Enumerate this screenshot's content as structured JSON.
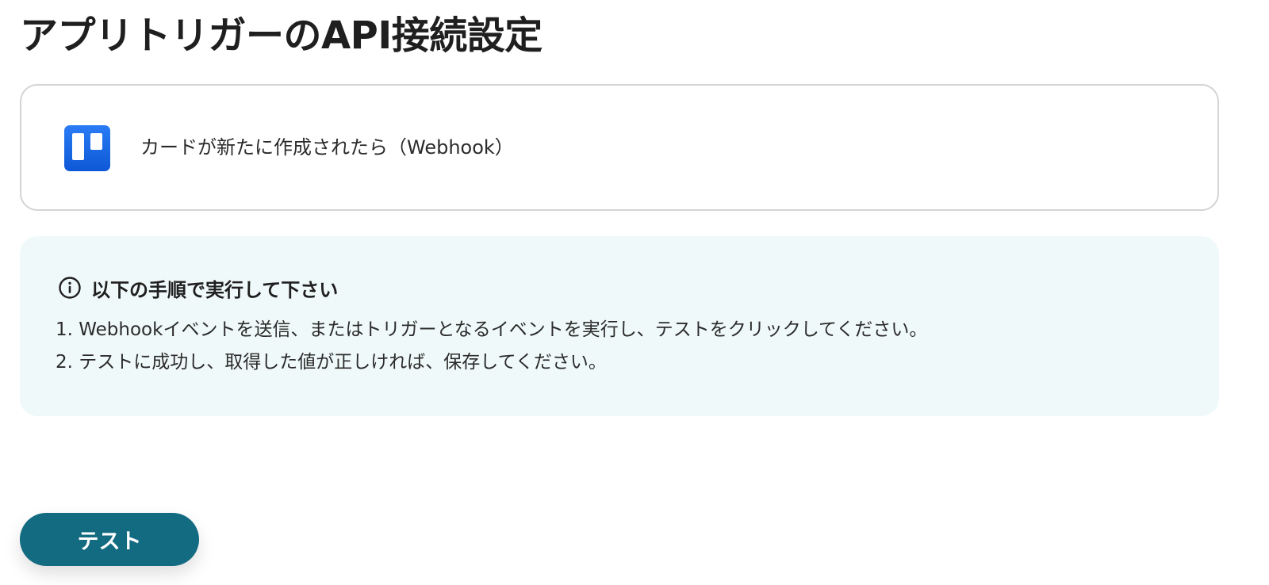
{
  "page": {
    "title": "アプリトリガーのAPI接続設定"
  },
  "trigger": {
    "app_icon": "trello-icon",
    "label": "カードが新たに作成されたら（Webhook）"
  },
  "instructions": {
    "icon": "info-icon",
    "title": "以下の手順で実行して下さい",
    "steps": [
      "1. Webhookイベントを送信、またはトリガーとなるイベントを実行し、テストをクリックしてください。",
      "2. テストに成功し、取得した値が正しければ、保存してください。"
    ]
  },
  "actions": {
    "test_label": "テスト"
  },
  "colors": {
    "button": "#136b82",
    "info_background": "#f0f9f9",
    "card_border": "#d4d4d4",
    "app_icon": "#0d58d6"
  }
}
